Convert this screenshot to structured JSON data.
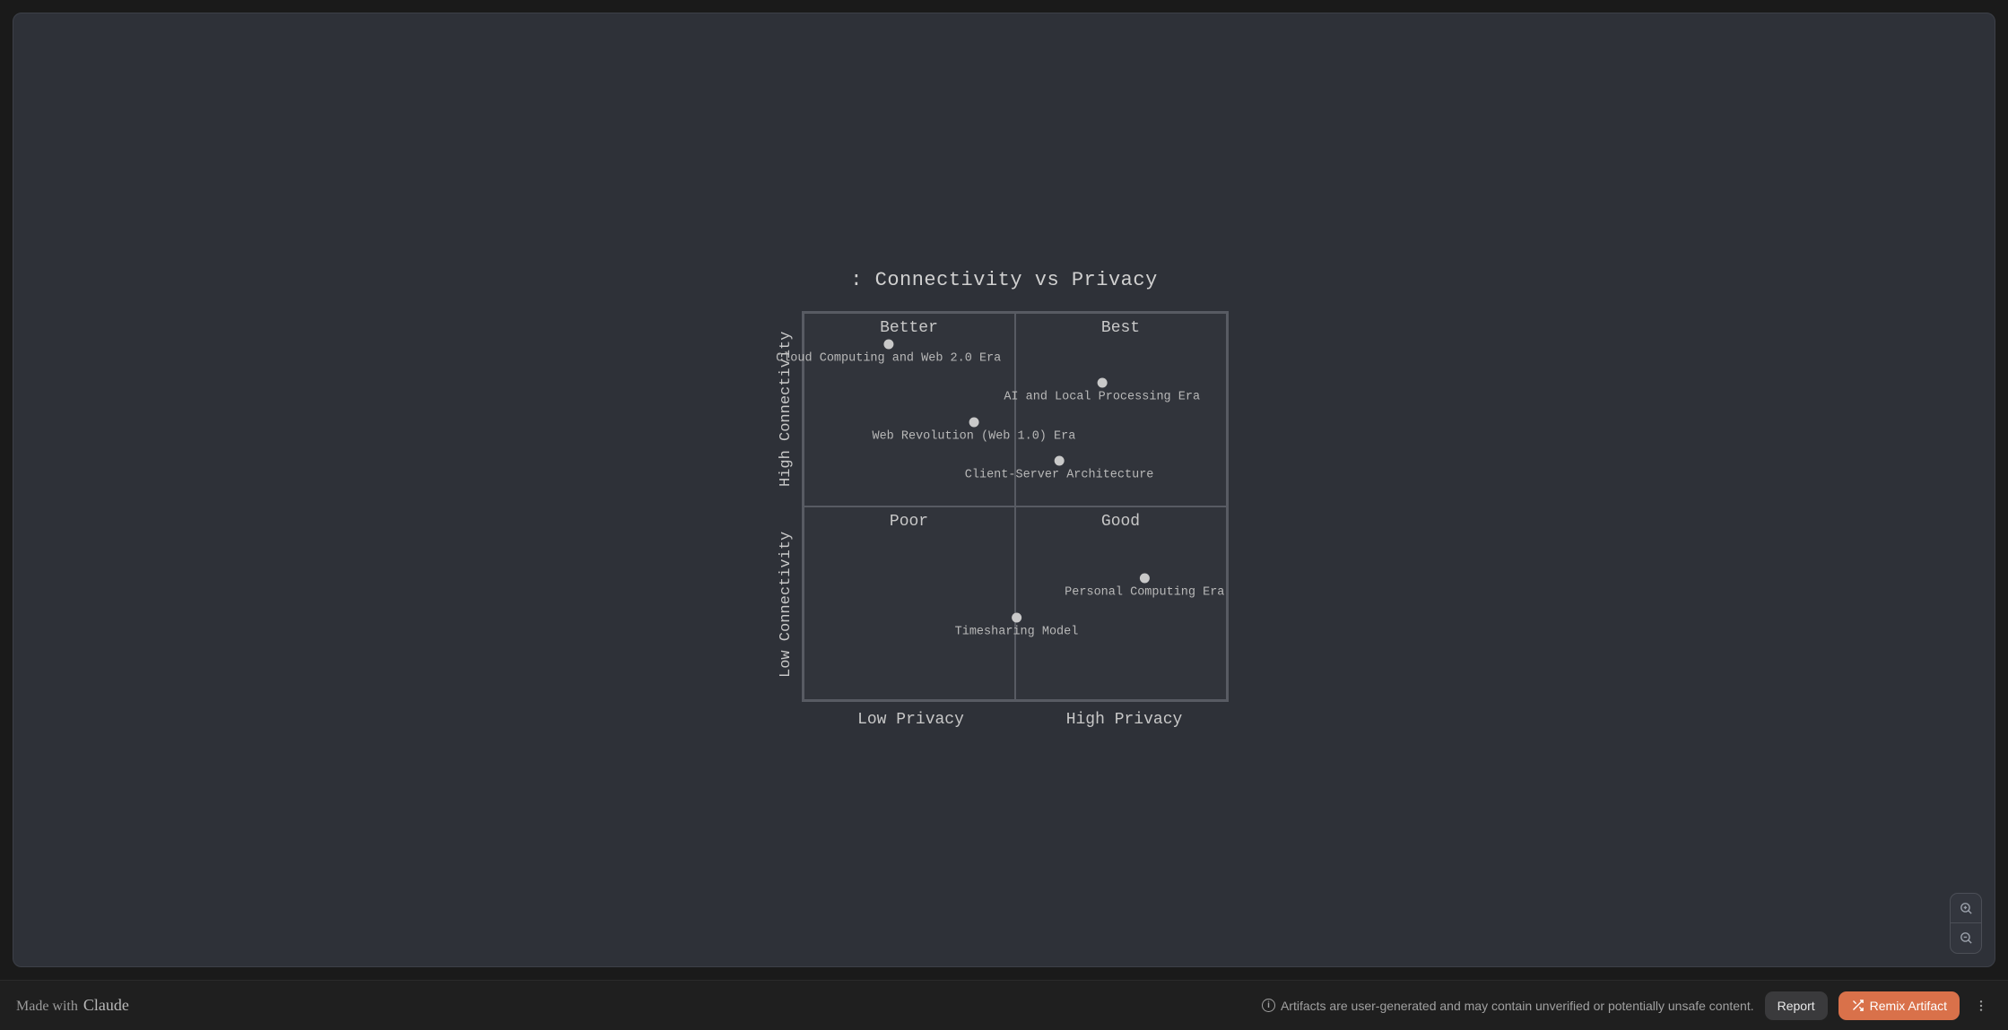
{
  "chart_data": {
    "type": "scatter",
    "title": ": Connectivity vs Privacy",
    "xlabel_low": "Low Privacy",
    "xlabel_high": "High Privacy",
    "ylabel_low": "Low Connectivity",
    "ylabel_high": "High Connectivity",
    "xlim": [
      0,
      1
    ],
    "ylim": [
      0,
      1
    ],
    "quadrants": {
      "top_left": "Better",
      "top_right": "Best",
      "bottom_left": "Poor",
      "bottom_right": "Good"
    },
    "points": [
      {
        "label": "Cloud Computing and Web 2.0 Era",
        "x": 0.2,
        "y": 0.9
      },
      {
        "label": "AI and Local Processing Era",
        "x": 0.7,
        "y": 0.8
      },
      {
        "label": "Web Revolution (Web 1.0) Era",
        "x": 0.4,
        "y": 0.7
      },
      {
        "label": "Client-Server Architecture",
        "x": 0.6,
        "y": 0.6
      },
      {
        "label": "Personal Computing Era",
        "x": 0.8,
        "y": 0.3
      },
      {
        "label": "Timesharing Model",
        "x": 0.5,
        "y": 0.2
      }
    ]
  },
  "footer": {
    "made_with": "Made with",
    "brand": "Claude",
    "disclaimer": "Artifacts are user-generated and may contain unverified or potentially unsafe content.",
    "report_label": "Report",
    "remix_label": "Remix Artifact"
  }
}
